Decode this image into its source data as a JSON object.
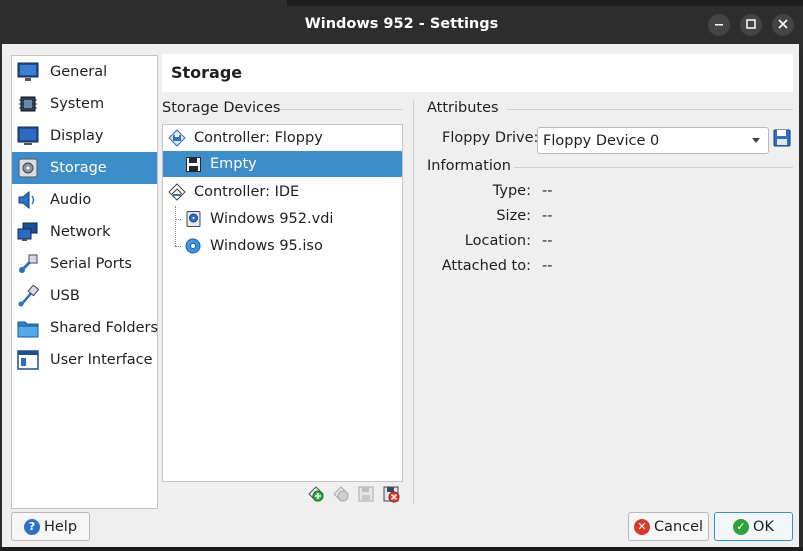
{
  "window": {
    "title": "Windows 952 - Settings",
    "controls": {
      "minimize": "–",
      "maximize": "□",
      "close": "✕"
    }
  },
  "sidebar": {
    "items": [
      {
        "label": "General",
        "icon": "general-icon",
        "selected": false
      },
      {
        "label": "System",
        "icon": "system-icon",
        "selected": false
      },
      {
        "label": "Display",
        "icon": "display-icon",
        "selected": false
      },
      {
        "label": "Storage",
        "icon": "storage-icon",
        "selected": true
      },
      {
        "label": "Audio",
        "icon": "audio-icon",
        "selected": false
      },
      {
        "label": "Network",
        "icon": "network-icon",
        "selected": false
      },
      {
        "label": "Serial Ports",
        "icon": "serial-ports-icon",
        "selected": false
      },
      {
        "label": "USB",
        "icon": "usb-icon",
        "selected": false
      },
      {
        "label": "Shared Folders",
        "icon": "shared-folders-icon",
        "selected": false
      },
      {
        "label": "User Interface",
        "icon": "user-interface-icon",
        "selected": false
      }
    ]
  },
  "header": {
    "title": "Storage"
  },
  "storage_devices": {
    "label": "Storage Devices",
    "tree": [
      {
        "label": "Controller: Floppy",
        "type": "controller",
        "icon": "floppy-controller-icon"
      },
      {
        "label": "Empty",
        "type": "attachment",
        "icon": "floppy-disk-icon",
        "selected": true
      },
      {
        "label": "Controller: IDE",
        "type": "controller",
        "icon": "ide-controller-icon"
      },
      {
        "label": "Windows 952.vdi",
        "type": "attachment",
        "icon": "hard-disk-icon"
      },
      {
        "label": "Windows 95.iso",
        "type": "attachment",
        "icon": "optical-disk-icon"
      }
    ],
    "toolbar": [
      "add-controller-icon",
      "remove-controller-icon",
      "add-attachment-icon",
      "remove-attachment-icon"
    ]
  },
  "attributes": {
    "label": "Attributes",
    "floppy_drive_label": "Floppy Drive:",
    "floppy_drive_value": "Floppy Device 0"
  },
  "information": {
    "label": "Information",
    "rows": [
      {
        "label": "Type:",
        "value": "--"
      },
      {
        "label": "Size:",
        "value": "--"
      },
      {
        "label": "Location:",
        "value": "--"
      },
      {
        "label": "Attached to:",
        "value": "--"
      }
    ]
  },
  "buttons": {
    "help": "Help",
    "cancel": "Cancel",
    "ok": "OK"
  },
  "colors": {
    "selection": "#3d8ec8",
    "titlebar": "#2d2d2d",
    "background": "#efefef"
  }
}
